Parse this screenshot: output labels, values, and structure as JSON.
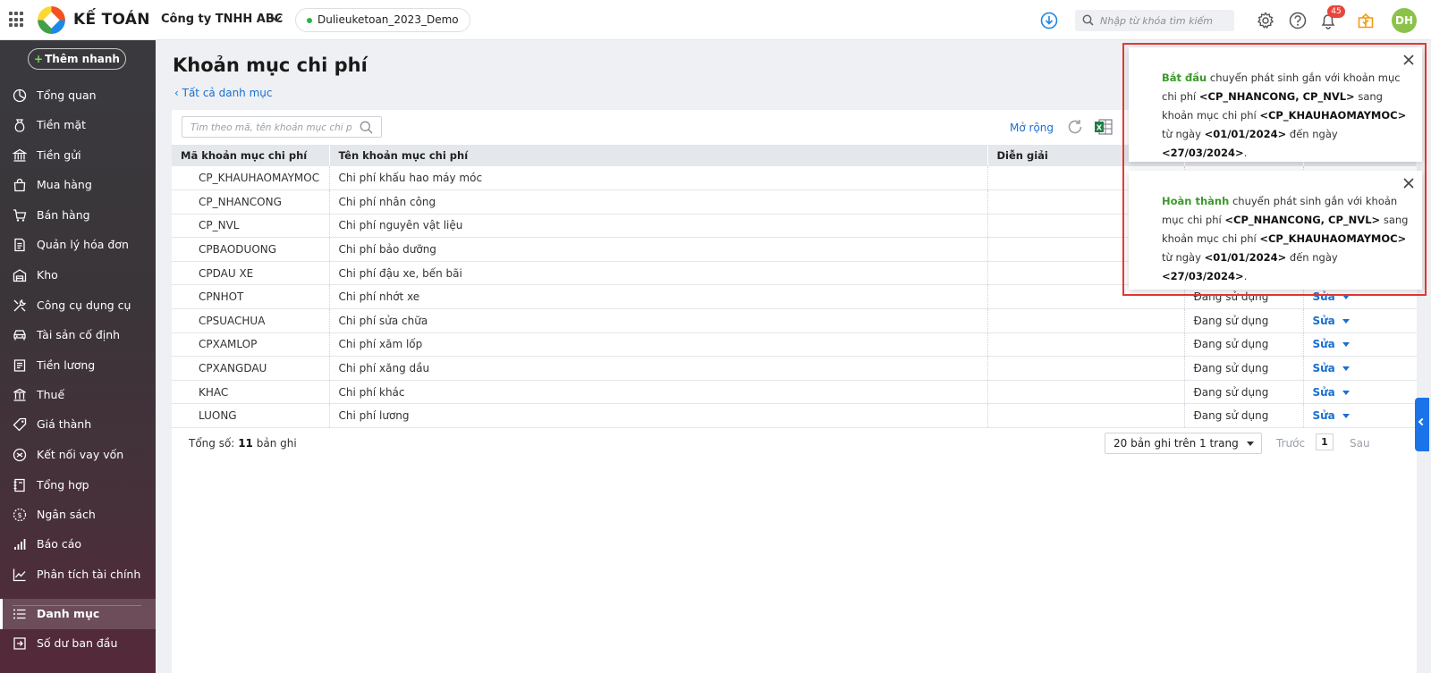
{
  "topbar": {
    "app_name": "KẾ TOÁN",
    "company": "Công ty TNHH ABC",
    "database": "Dulieuketoan_2023_Demo",
    "search_placeholder": "Nhập từ khóa tìm kiếm",
    "notification_count": "45",
    "avatar_initials": "DH"
  },
  "sidebar": {
    "quick_add": "Thêm nhanh",
    "items": [
      {
        "label": "Tổng quan",
        "icon": "dashboard-icon"
      },
      {
        "label": "Tiền mặt",
        "icon": "cash-bag-icon"
      },
      {
        "label": "Tiền gửi",
        "icon": "bank-icon"
      },
      {
        "label": "Mua hàng",
        "icon": "shopping-bag-icon"
      },
      {
        "label": "Bán hàng",
        "icon": "cart-icon"
      },
      {
        "label": "Quản lý hóa đơn",
        "icon": "invoice-icon"
      },
      {
        "label": "Kho",
        "icon": "warehouse-icon"
      },
      {
        "label": "Công cụ dụng cụ",
        "icon": "tools-icon"
      },
      {
        "label": "Tài sản cố định",
        "icon": "car-icon"
      },
      {
        "label": "Tiền lương",
        "icon": "salary-icon"
      },
      {
        "label": "Thuế",
        "icon": "tax-building-icon"
      },
      {
        "label": "Giá thành",
        "icon": "price-tag-icon"
      },
      {
        "label": "Kết nối vay vốn",
        "icon": "loan-link-icon"
      },
      {
        "label": "Tổng hợp",
        "icon": "ledger-icon"
      },
      {
        "label": "Ngân sách",
        "icon": "budget-icon"
      },
      {
        "label": "Báo cáo",
        "icon": "bar-chart-icon"
      },
      {
        "label": "Phân tích tài chính",
        "icon": "line-chart-icon"
      },
      {
        "label": "Danh mục",
        "icon": "list-icon"
      },
      {
        "label": "Số dư ban đầu",
        "icon": "opening-balance-icon"
      }
    ]
  },
  "page": {
    "title": "Khoản mục chi phí",
    "back_link": "Tất cả danh mục",
    "search_placeholder": "Tìm theo mã, tên khoản mục chi phí",
    "expand_label": "Mở rộng"
  },
  "table": {
    "headers": [
      "Mã khoản mục chi phí",
      "Tên khoản mục chi phí",
      "Diễn giải",
      "",
      ""
    ],
    "edit_label": "Sửa",
    "rows": [
      {
        "code": "CP_KHAUHAOMAYMOC",
        "name": "Chi phí khấu hao máy móc",
        "desc": "",
        "status": ""
      },
      {
        "code": "CP_NHANCONG",
        "name": "Chi phí nhân công",
        "desc": "",
        "status": ""
      },
      {
        "code": "CP_NVL",
        "name": "Chi phí nguyên vật liệu",
        "desc": "",
        "status": ""
      },
      {
        "code": "CPBAODUONG",
        "name": "Chi phí bảo dưỡng",
        "desc": "",
        "status": ""
      },
      {
        "code": "CPDAU XE",
        "name": "Chi phí đậu xe, bến bãi",
        "desc": "",
        "status": ""
      },
      {
        "code": "CPNHOT",
        "name": "Chi phí nhớt xe",
        "desc": "",
        "status": "Đang sử dụng"
      },
      {
        "code": "CPSUACHUA",
        "name": "Chi phí sửa chữa",
        "desc": "",
        "status": "Đang sử dụng"
      },
      {
        "code": "CPXAMLOP",
        "name": "Chi phí xăm lốp",
        "desc": "",
        "status": "Đang sử dụng"
      },
      {
        "code": "CPXANGDAU",
        "name": "Chi phí xăng dầu",
        "desc": "",
        "status": "Đang sử dụng"
      },
      {
        "code": "KHAC",
        "name": "Chi phí khác",
        "desc": "",
        "status": "Đang sử dụng"
      },
      {
        "code": "LUONG",
        "name": "Chi phí lương",
        "desc": "",
        "status": "Đang sử dụng"
      }
    ]
  },
  "footer": {
    "total_prefix": "Tổng số:",
    "total_count": "11",
    "total_suffix": "bản ghi",
    "page_size": "20 bản ghi trên 1 trang",
    "prev": "Trước",
    "page": "1",
    "next": "Sau"
  },
  "notifications": [
    {
      "status": "Bắt đầu",
      "t1": "chuyển phát sinh gắn với khoản mục chi phí",
      "from": "<CP_NHANCONG, CP_NVL>",
      "t2": "sang khoản mục chi phí",
      "to": "<CP_KHAUHAOMAYMOC>",
      "t3": "từ ngày",
      "start": "<01/01/2024>",
      "t4": "đến ngày",
      "end": "<27/03/2024>",
      "t5": "."
    },
    {
      "status": "Hoàn thành",
      "t1": "chuyển phát sinh gắn với khoản mục chi phí",
      "from": "<CP_NHANCONG, CP_NVL>",
      "t2": "sang khoản mục chi phí",
      "to": "<CP_KHAUHAOMAYMOC>",
      "t3": "từ ngày",
      "start": "<01/01/2024>",
      "t4": "đến ngày",
      "end": "<27/03/2024>",
      "t5": "."
    }
  ],
  "colors": {
    "accent_blue": "#1a6fd0",
    "success_green": "#3a9a2a",
    "highlight_red": "#e53935",
    "badge_red": "#e8453c"
  }
}
